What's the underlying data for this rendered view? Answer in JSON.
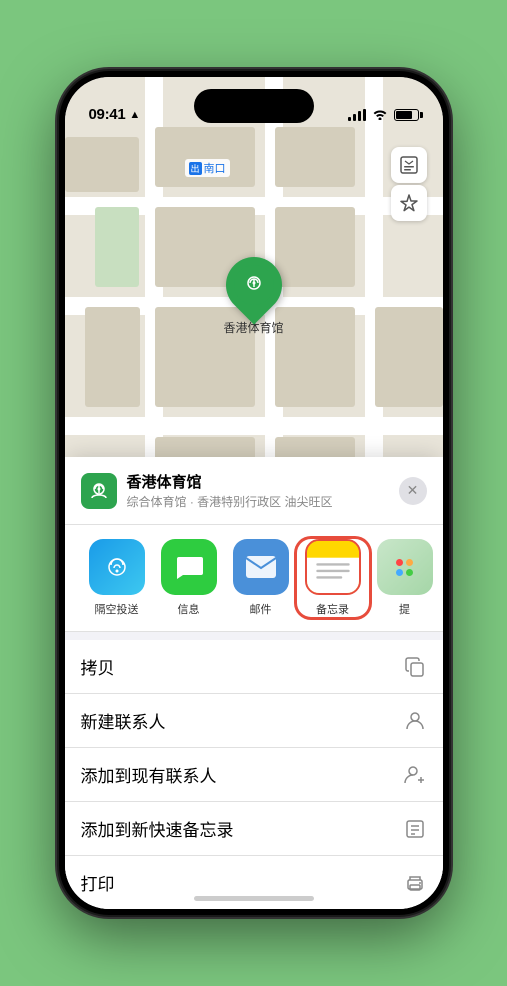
{
  "status_bar": {
    "time": "09:41",
    "location_arrow": "▶"
  },
  "map": {
    "label_entrance": "南口",
    "pin_label": "香港体育馆"
  },
  "location_card": {
    "name": "香港体育馆",
    "subtitle": "综合体育馆 · 香港特别行政区 油尖旺区",
    "close_label": "✕"
  },
  "share_items": [
    {
      "id": "airdrop",
      "label": "隔空投送",
      "type": "airdrop"
    },
    {
      "id": "messages",
      "label": "信息",
      "type": "messages"
    },
    {
      "id": "mail",
      "label": "邮件",
      "type": "mail"
    },
    {
      "id": "notes",
      "label": "备忘录",
      "type": "notes"
    },
    {
      "id": "more",
      "label": "提",
      "type": "more"
    }
  ],
  "actions": [
    {
      "id": "copy",
      "label": "拷贝",
      "icon": "copy"
    },
    {
      "id": "new-contact",
      "label": "新建联系人",
      "icon": "person"
    },
    {
      "id": "add-contact",
      "label": "添加到现有联系人",
      "icon": "person-add"
    },
    {
      "id": "quick-note",
      "label": "添加到新快速备忘录",
      "icon": "note"
    },
    {
      "id": "print",
      "label": "打印",
      "icon": "print"
    }
  ]
}
